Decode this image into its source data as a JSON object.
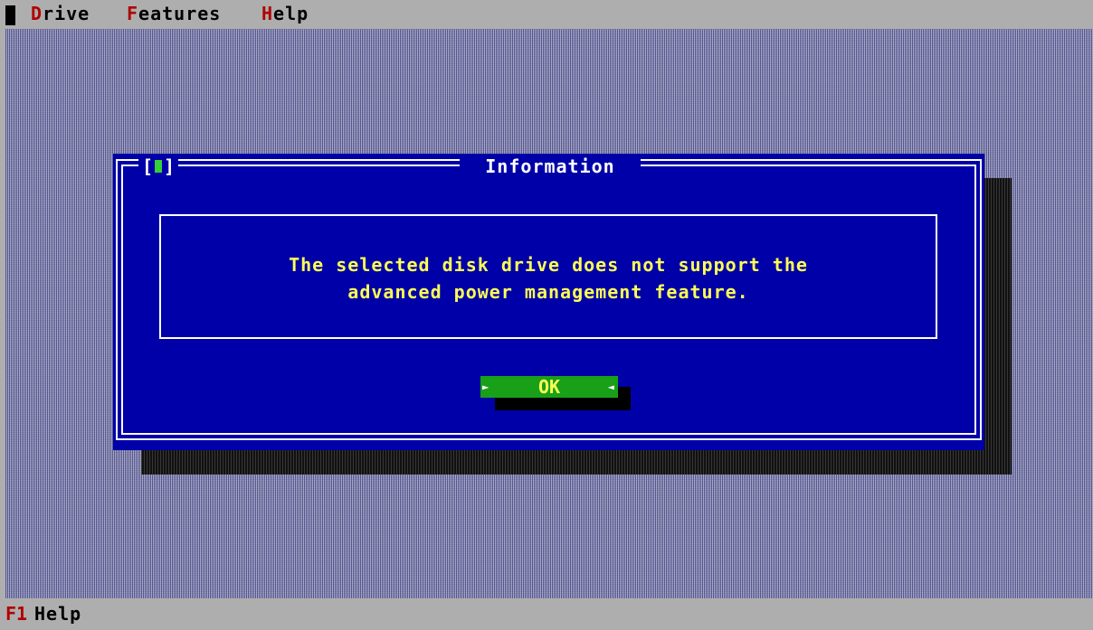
{
  "menu": {
    "items": [
      {
        "hotkey": "D",
        "rest": "rive"
      },
      {
        "hotkey": "F",
        "rest": "eatures"
      },
      {
        "hotkey": "H",
        "rest": "elp"
      }
    ]
  },
  "dialog": {
    "close_open": "[",
    "close_close": "]",
    "title": "Information",
    "message_line1": "The selected disk drive does not support the",
    "message_line2": "advanced power management feature.",
    "ok_label": "OK",
    "ok_arrow_left": "►",
    "ok_arrow_right": "◄"
  },
  "status": {
    "key": "F1",
    "label": "Help"
  },
  "colors": {
    "dialog_bg": "#0000a8",
    "message_text": "#ffff55",
    "button_bg": "#18a018",
    "hotkey": "#b00000",
    "bar_bg": "#aeaeae"
  }
}
